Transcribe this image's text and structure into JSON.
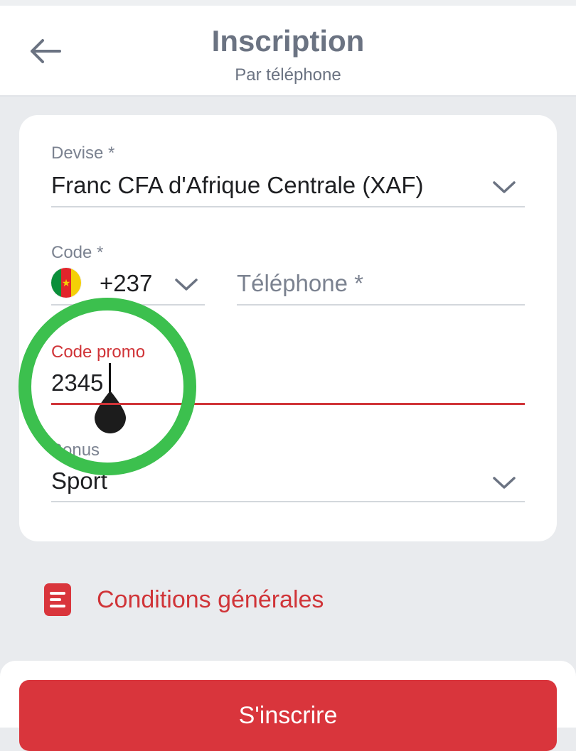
{
  "header": {
    "title": "Inscription",
    "subtitle": "Par téléphone"
  },
  "form": {
    "currency": {
      "label": "Devise *",
      "value": "Franc CFA d'Afrique Centrale (XAF)"
    },
    "code": {
      "label": "Code *",
      "value": "+237",
      "flag": "cameroon-flag"
    },
    "phone": {
      "placeholder": "Téléphone *",
      "value": ""
    },
    "promo": {
      "label": "Code promo",
      "value": "2345"
    },
    "bonus": {
      "label": "Bonus",
      "value": "Sport"
    }
  },
  "terms": {
    "label": "Conditions générales",
    "icon": "document-icon"
  },
  "actions": {
    "signup_label": "S'inscrire"
  },
  "colors": {
    "accent": "#d9353c",
    "text_muted": "#6b7382",
    "highlight_ring": "#3cc04e",
    "background": "#e9ebee"
  }
}
